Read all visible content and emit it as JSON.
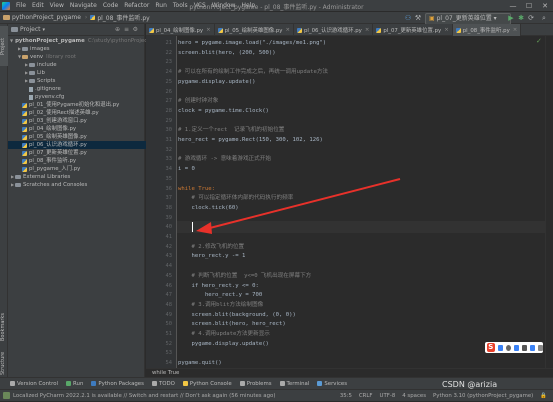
{
  "window": {
    "title": "pythonProject_pygame - pl_08_事件监听.py - Administrator",
    "menu": [
      "File",
      "Edit",
      "View",
      "Navigate",
      "Code",
      "Refactor",
      "Run",
      "Tools",
      "VCS",
      "Window",
      "Help"
    ],
    "minimize": "—",
    "maximize": "☐",
    "close": "✕"
  },
  "navbar": {
    "project": "pythonProject_pygame",
    "file": "pl_08_事件监听.py",
    "run_config": "pl_07_更新英雄位置"
  },
  "left_stripe": {
    "project_tab": "Project",
    "bookmarks_tab": "Bookmarks",
    "structure_tab": "Structure"
  },
  "project_panel": {
    "title": "Project",
    "tree": [
      {
        "label": "pythonProject_pygame",
        "path": "C:\\study\\pythonProject",
        "kind": "folder",
        "bold": true,
        "expanded": true
      },
      {
        "label": "images",
        "kind": "folder"
      },
      {
        "label": "venv",
        "path": "library root",
        "kind": "folder-yellow",
        "expanded": true
      },
      {
        "label": "include",
        "kind": "folder"
      },
      {
        "label": "Lib",
        "kind": "folder"
      },
      {
        "label": "Scripts",
        "kind": "folder"
      },
      {
        "label": ".gitignore",
        "kind": "file"
      },
      {
        "label": "pyvenv.cfg",
        "kind": "file"
      },
      {
        "label": "pl_01_使用Pygame初始化和退出.py",
        "kind": "py"
      },
      {
        "label": "pl_02_使用Rect描述英雄.py",
        "kind": "py"
      },
      {
        "label": "pl_03_创建游戏窗口.py",
        "kind": "py"
      },
      {
        "label": "pl_04_绘制图像.py",
        "kind": "py"
      },
      {
        "label": "pl_05_绘制英雄图像.py",
        "kind": "py"
      },
      {
        "label": "pl_06_认识游戏循环.py",
        "kind": "py",
        "selected": true
      },
      {
        "label": "pl_07_更新英雄位置.py",
        "kind": "py"
      },
      {
        "label": "pl_08_事件监听.py",
        "kind": "py"
      },
      {
        "label": "pl_pygame_入门.py",
        "kind": "py"
      },
      {
        "label": "External Libraries",
        "kind": "lib"
      },
      {
        "label": "Scratches and Consoles",
        "kind": "lib"
      }
    ]
  },
  "editor_tabs": [
    {
      "label": "pl_04_绘制图像.py"
    },
    {
      "label": "pl_05_绘制英雄图像.py"
    },
    {
      "label": "pl_06_认识游戏循环.py"
    },
    {
      "label": "pl_07_更新英雄位置.py"
    },
    {
      "label": "pl_08_事件监听.py",
      "active": true
    }
  ],
  "editor": {
    "lines": [
      {
        "n": "21",
        "t": "hero = pygame.image.load(\"./images/me1.png\")",
        "k": "code"
      },
      {
        "n": "22",
        "t": "screen.blit(hero, (200, 500))",
        "k": "code"
      },
      {
        "n": "23",
        "t": "",
        "k": "code"
      },
      {
        "n": "24",
        "t": "# 可以在所有的绘制工作完成之后，再统一调用update方法",
        "k": "cmt"
      },
      {
        "n": "25",
        "t": "pygame.display.update()",
        "k": "code"
      },
      {
        "n": "26",
        "t": "",
        "k": "code"
      },
      {
        "n": "27",
        "t": "# 创建时钟对象",
        "k": "cmt"
      },
      {
        "n": "28",
        "t": "clock = pygame.time.Clock()",
        "k": "code"
      },
      {
        "n": "29",
        "t": "",
        "k": "code"
      },
      {
        "n": "30",
        "t": "# 1.定义一个rect  记录飞机的初始位置",
        "k": "cmt"
      },
      {
        "n": "31",
        "t": "hero_rect = pygame.Rect(150, 300, 102, 126)",
        "k": "code"
      },
      {
        "n": "32",
        "t": "",
        "k": "code"
      },
      {
        "n": "33",
        "t": "# 游戏循环 -> 意味着游戏正式开始",
        "k": "cmt"
      },
      {
        "n": "34",
        "t": "i = 0",
        "k": "code"
      },
      {
        "n": "35",
        "t": "",
        "k": "code"
      },
      {
        "n": "36",
        "t": "while True:",
        "k": "kw"
      },
      {
        "n": "37",
        "t": "    # 可以指定循环体内部的代码执行的频率",
        "k": "cmt"
      },
      {
        "n": "38",
        "t": "    clock.tick(60)",
        "k": "code"
      },
      {
        "n": "39",
        "t": "",
        "k": "code"
      },
      {
        "n": "40",
        "t": "    ",
        "k": "code"
      },
      {
        "n": "41",
        "t": "",
        "k": "code"
      },
      {
        "n": "42",
        "t": "    # 2.修改飞机的位置",
        "k": "cmt"
      },
      {
        "n": "43",
        "t": "    hero_rect.y -= 1",
        "k": "code"
      },
      {
        "n": "44",
        "t": "",
        "k": "code"
      },
      {
        "n": "45",
        "t": "    # 判断飞机的位置  y<=0 飞机出现在屏幕下方",
        "k": "cmt"
      },
      {
        "n": "46",
        "t": "    if hero_rect.y <= 0:",
        "k": "code"
      },
      {
        "n": "47",
        "t": "        hero_rect.y = 700",
        "k": "code"
      },
      {
        "n": "48",
        "t": "    # 3.调用blit方法绘制图像",
        "k": "cmt"
      },
      {
        "n": "49",
        "t": "    screen.blit(background, (0, 0))",
        "k": "code"
      },
      {
        "n": "50",
        "t": "    screen.blit(hero, hero_rect)",
        "k": "code"
      },
      {
        "n": "51",
        "t": "    # 4.调用update方法更新显示",
        "k": "cmt"
      },
      {
        "n": "52",
        "t": "    pygame.display.update()",
        "k": "code"
      },
      {
        "n": "53",
        "t": "",
        "k": "code"
      },
      {
        "n": "54",
        "t": "pygame.quit()",
        "k": "code"
      }
    ],
    "breadcrumb": "while True",
    "accent_arrow_color": "#e8312a"
  },
  "tool_tabs": [
    "Version Control",
    "Run",
    "Python Packages",
    "TODO",
    "Python Console",
    "Problems",
    "Terminal",
    "Services"
  ],
  "status": {
    "message": "Localized PyCharm 2022.2.1 is available // Switch and restart // Don't ask again (56 minutes ago)",
    "position": "35:5",
    "line_sep": "CRLF",
    "encoding": "UTF-8",
    "indent": "4 spaces",
    "interpreter": "Python 3.10 (pythonProject_pygame)"
  },
  "watermark": "CSDN @arizia"
}
